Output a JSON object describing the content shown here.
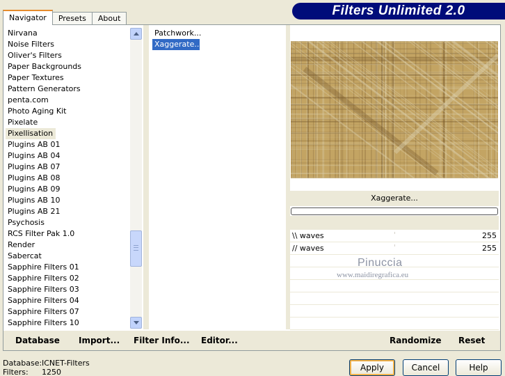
{
  "window": {
    "title": "Filters Unlimited 2.0"
  },
  "tabs": [
    {
      "label": "Navigator",
      "active": true
    },
    {
      "label": "Presets",
      "active": false
    },
    {
      "label": "About",
      "active": false
    }
  ],
  "categories": {
    "items": [
      "Nirvana",
      "Noise Filters",
      "Oliver's Filters",
      "Paper Backgrounds",
      "Paper Textures",
      "Pattern Generators",
      "penta.com",
      "Photo Aging Kit",
      "Pixelate",
      "Pixellisation",
      "Plugins AB 01",
      "Plugins AB 04",
      "Plugins AB 07",
      "Plugins AB 08",
      "Plugins AB 09",
      "Plugins AB 10",
      "Plugins AB 21",
      "Psychosis",
      "RCS Filter Pak 1.0",
      "Render",
      "Sabercat",
      "Sapphire Filters 01",
      "Sapphire Filters 02",
      "Sapphire Filters 03",
      "Sapphire Filters 04",
      "Sapphire Filters 07",
      "Sapphire Filters 10"
    ],
    "selected": "Pixellisation"
  },
  "filters": {
    "items": [
      "Patchwork...",
      "Xaggerate..."
    ],
    "selected": "Xaggerate..."
  },
  "preview": {
    "filter_name": "Xaggerate...",
    "progress": 0,
    "colors": {
      "base": "#c3a463",
      "light": "#ddd2b0",
      "dark": "#7a5c2e"
    }
  },
  "parameters": [
    {
      "label": "\\\\ waves",
      "value": "255"
    },
    {
      "label": "// waves",
      "value": "255"
    }
  ],
  "watermark": {
    "name": "Pinuccia",
    "url": "www.maidiregrafica.eu"
  },
  "toolbar": {
    "database": "Database",
    "import": "Import...",
    "filter_info": "Filter Info...",
    "editor": "Editor...",
    "randomize": "Randomize",
    "reset": "Reset"
  },
  "status": {
    "database_label": "Database:",
    "database_value": "ICNET-Filters",
    "filters_label": "Filters:",
    "filters_value": "1250"
  },
  "buttons": {
    "apply": "Apply",
    "cancel": "Cancel",
    "help": "Help"
  }
}
